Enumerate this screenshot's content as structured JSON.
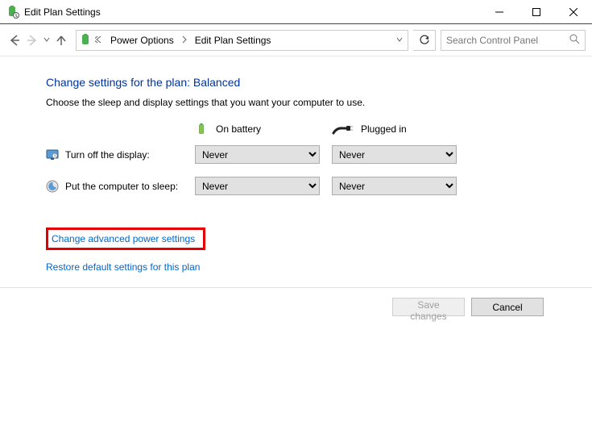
{
  "window": {
    "title": "Edit Plan Settings"
  },
  "breadcrumb": {
    "item1": "Power Options",
    "item2": "Edit Plan Settings"
  },
  "search": {
    "placeholder": "Search Control Panel"
  },
  "page": {
    "heading": "Change settings for the plan: Balanced",
    "subtext": "Choose the sleep and display settings that you want your computer to use."
  },
  "columns": {
    "battery": "On battery",
    "plugged": "Plugged in"
  },
  "rows": {
    "display": {
      "label": "Turn off the display:",
      "battery": "Never",
      "plugged": "Never"
    },
    "sleep": {
      "label": "Put the computer to sleep:",
      "battery": "Never",
      "plugged": "Never"
    }
  },
  "links": {
    "advanced": "Change advanced power settings",
    "restore": "Restore default settings for this plan"
  },
  "buttons": {
    "save": "Save changes",
    "cancel": "Cancel"
  }
}
